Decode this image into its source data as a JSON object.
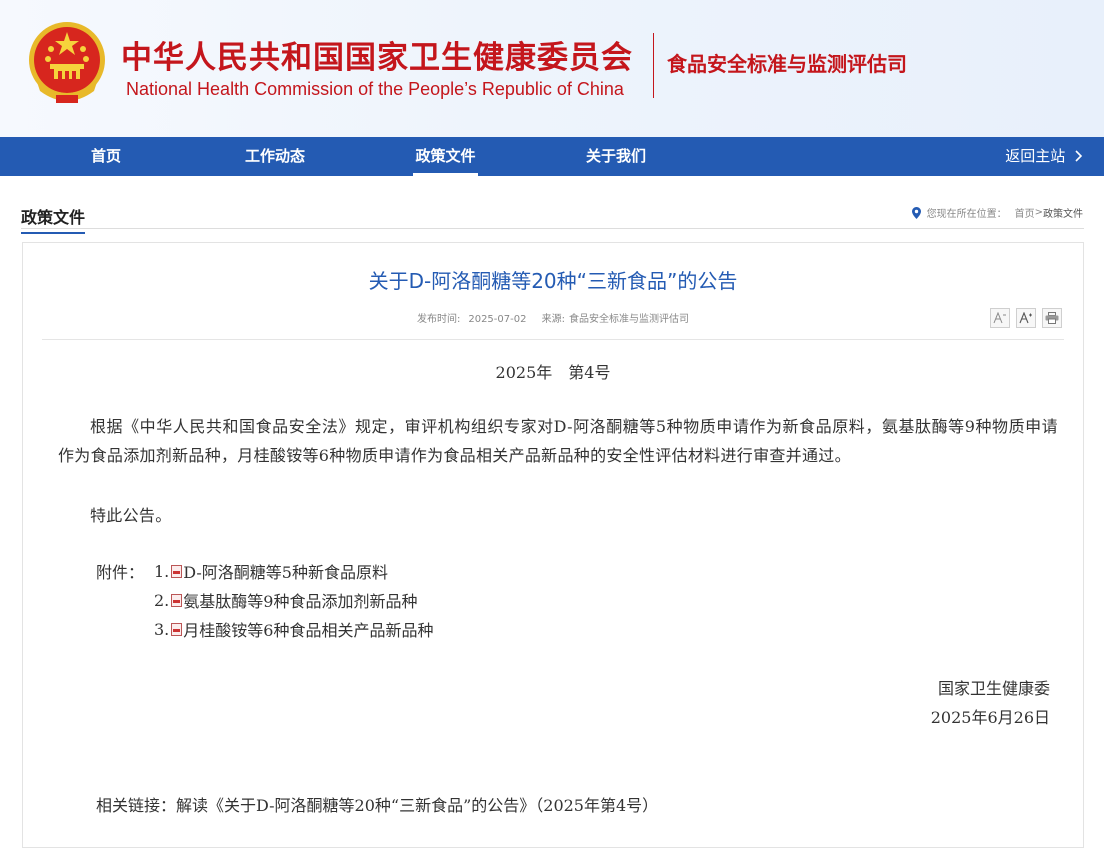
{
  "header": {
    "title_cn": "中华人民共和国国家卫生健康委员会",
    "title_en": "National Health Commission of the People’s  Republic of China",
    "department": "食品安全标准与监测评估司",
    "emblem_icon": "national-emblem-icon"
  },
  "nav": {
    "items": [
      {
        "label": "首页",
        "active": false
      },
      {
        "label": "工作动态",
        "active": false
      },
      {
        "label": "政策文件",
        "active": true
      },
      {
        "label": "关于我们",
        "active": false
      }
    ],
    "back_label": "返回主站",
    "back_icon": "chevron-right-icon",
    "bg_color": "#245bb3"
  },
  "section": {
    "title": "政策文件",
    "breadcrumb_prefix": "您现在所在位置：",
    "breadcrumb_home": "首页",
    "breadcrumb_sep": ">",
    "breadcrumb_current": "政策文件",
    "pin_icon": "location-pin-icon"
  },
  "article": {
    "title": "关于D-阿洛酮糖等20种“三新食品”的公告",
    "publish_label": "发布时间:",
    "publish_date": "2025-07-02",
    "source_label": "来源:",
    "source": "食品安全标准与监测评估司",
    "tools": {
      "font_decrease": "A-",
      "font_increase": "A+",
      "print_icon": "print-icon"
    },
    "doc_number": "2025年　第4号",
    "paragraph1": "根据《中华人民共和国食品安全法》规定，审评机构组织专家对D-阿洛酮糖等5种物质申请作为新食品原料，氨基肽酶等9种物质申请作为食品添加剂新品种，月桂酸铵等6种物质申请作为食品相关产品新品种的安全性评估材料进行审查并通过。",
    "paragraph2": "特此公告。",
    "attachments_label": "附件：",
    "attachments": [
      {
        "num": "1.",
        "name": "D-阿洛酮糖等5种新食品原料"
      },
      {
        "num": "2.",
        "name": "氨基肽酶等9种食品添加剂新品种"
      },
      {
        "num": "3.",
        "name": "月桂酸铵等6种食品相关产品新品种"
      }
    ],
    "signature_org": "国家卫生健康委",
    "signature_date": "2025年6月26日",
    "related_label": "相关链接：",
    "related_link": "解读《关于D-阿洛酮糖等20种“三新食品”的公告》（2025年第4号）"
  }
}
